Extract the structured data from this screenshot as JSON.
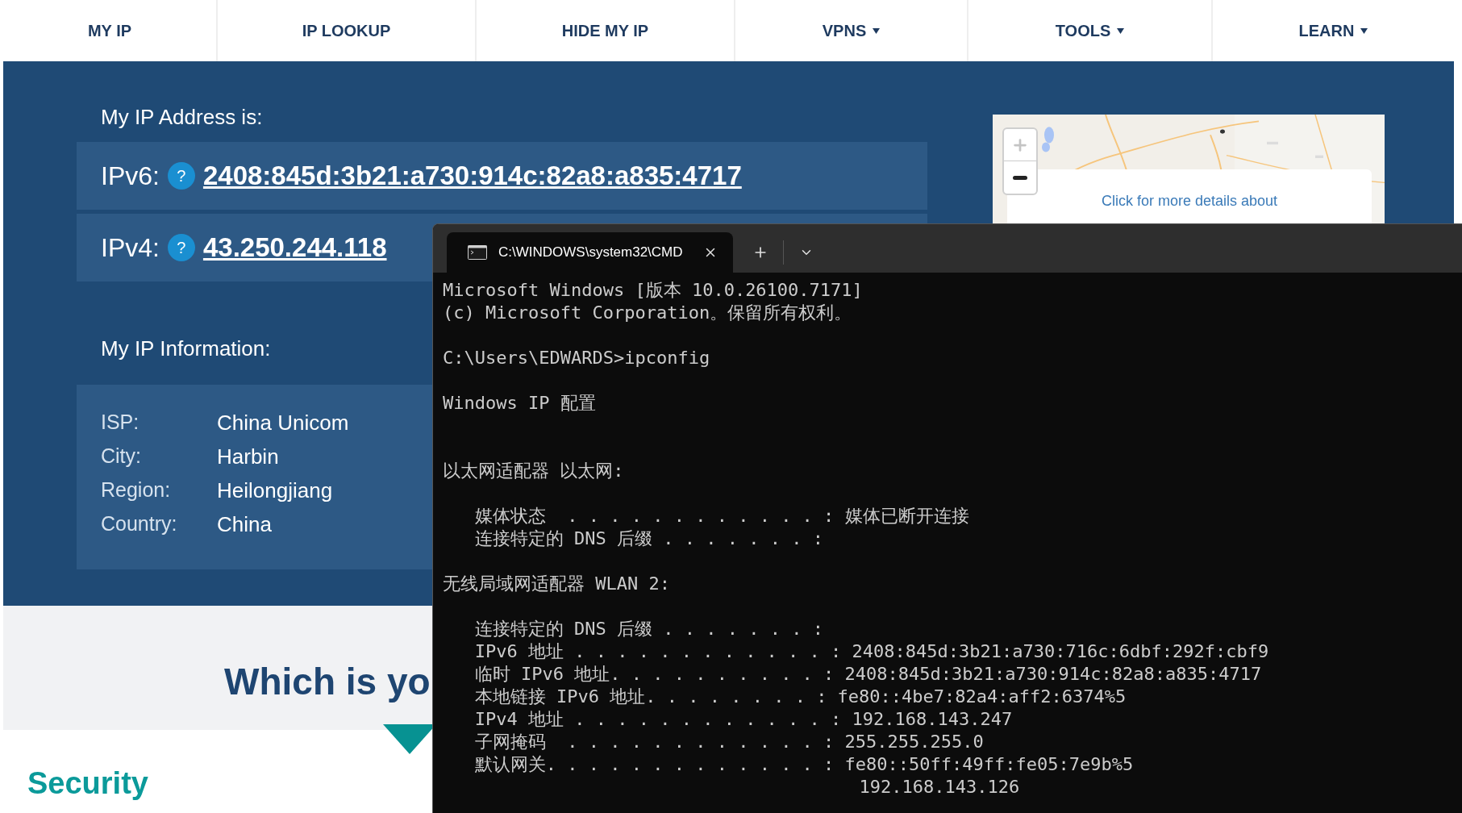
{
  "nav": [
    {
      "label": "MY IP",
      "dropdown": false
    },
    {
      "label": "IP LOOKUP",
      "dropdown": false
    },
    {
      "label": "HIDE MY IP",
      "dropdown": false
    },
    {
      "label": "VPNS",
      "dropdown": true
    },
    {
      "label": "TOOLS",
      "dropdown": true
    },
    {
      "label": "LEARN",
      "dropdown": true
    }
  ],
  "ip_address": {
    "heading": "My IP Address is:",
    "rows": [
      {
        "label": "IPv6:",
        "help": "?",
        "value": "2408:845d:3b21:a730:914c:82a8:a835:4717"
      },
      {
        "label": "IPv4:",
        "help": "?",
        "value": "43.250.244.118"
      }
    ]
  },
  "map": {
    "kind": "picture",
    "popup_text": "Click for more details about"
  },
  "ip_info": {
    "heading": "My IP Information:",
    "rows": [
      {
        "label": "ISP:",
        "value": "China Unicom"
      },
      {
        "label": "City:",
        "value": "Harbin"
      },
      {
        "label": "Region:",
        "value": "Heilongjiang"
      },
      {
        "label": "Country:",
        "value": "China"
      }
    ]
  },
  "section_heading": "Which is yo",
  "card_title": "Security",
  "terminal": {
    "tab_title": "C:\\WINDOWS\\system32\\CMD",
    "lines": [
      {
        "kind": "text",
        "text": "Microsoft Windows [版本 10.0.26100.7171]"
      },
      {
        "kind": "text",
        "text": "(c) Microsoft Corporation。保留所有权利。"
      },
      {
        "kind": "blank"
      },
      {
        "kind": "text",
        "text": "C:\\Users\\EDWARDS>ipconfig"
      },
      {
        "kind": "blank"
      },
      {
        "kind": "text",
        "text": "Windows IP 配置"
      },
      {
        "kind": "blank"
      },
      {
        "kind": "blank"
      },
      {
        "kind": "text",
        "text": "以太网适配器 以太网:"
      },
      {
        "kind": "blank"
      },
      {
        "kind": "text",
        "text": "   媒体状态  . . . . . . . . . . . . : 媒体已断开连接"
      },
      {
        "kind": "text",
        "text": "   连接特定的 DNS 后缀 . . . . . . . :"
      },
      {
        "kind": "blank"
      },
      {
        "kind": "text",
        "text": "无线局域网适配器 WLAN 2:"
      },
      {
        "kind": "blank"
      },
      {
        "kind": "text",
        "text": "   连接特定的 DNS 后缀 . . . . . . . :"
      },
      {
        "kind": "text",
        "text": "   IPv6 地址 . . . . . . . . . . . . : 2408:845d:3b21:a730:716c:6dbf:292f:cbf9"
      },
      {
        "kind": "text",
        "text": "   临时 IPv6 地址. . . . . . . . . . : 2408:845d:3b21:a730:914c:82a8:a835:4717"
      },
      {
        "kind": "text",
        "text": "   本地链接 IPv6 地址. . . . . . . . : fe80::4be7:82a4:aff2:6374%5"
      },
      {
        "kind": "text",
        "text": "   IPv4 地址 . . . . . . . . . . . . : 192.168.143.247"
      },
      {
        "kind": "text",
        "text": "   子网掩码  . . . . . . . . . . . . : 255.255.255.0"
      },
      {
        "kind": "text",
        "text": "   默认网关. . . . . . . . . . . . . : fe80::50ff:49ff:fe05:7e9b%5"
      },
      {
        "kind": "text",
        "text": "                                       192.168.143.126"
      }
    ]
  }
}
